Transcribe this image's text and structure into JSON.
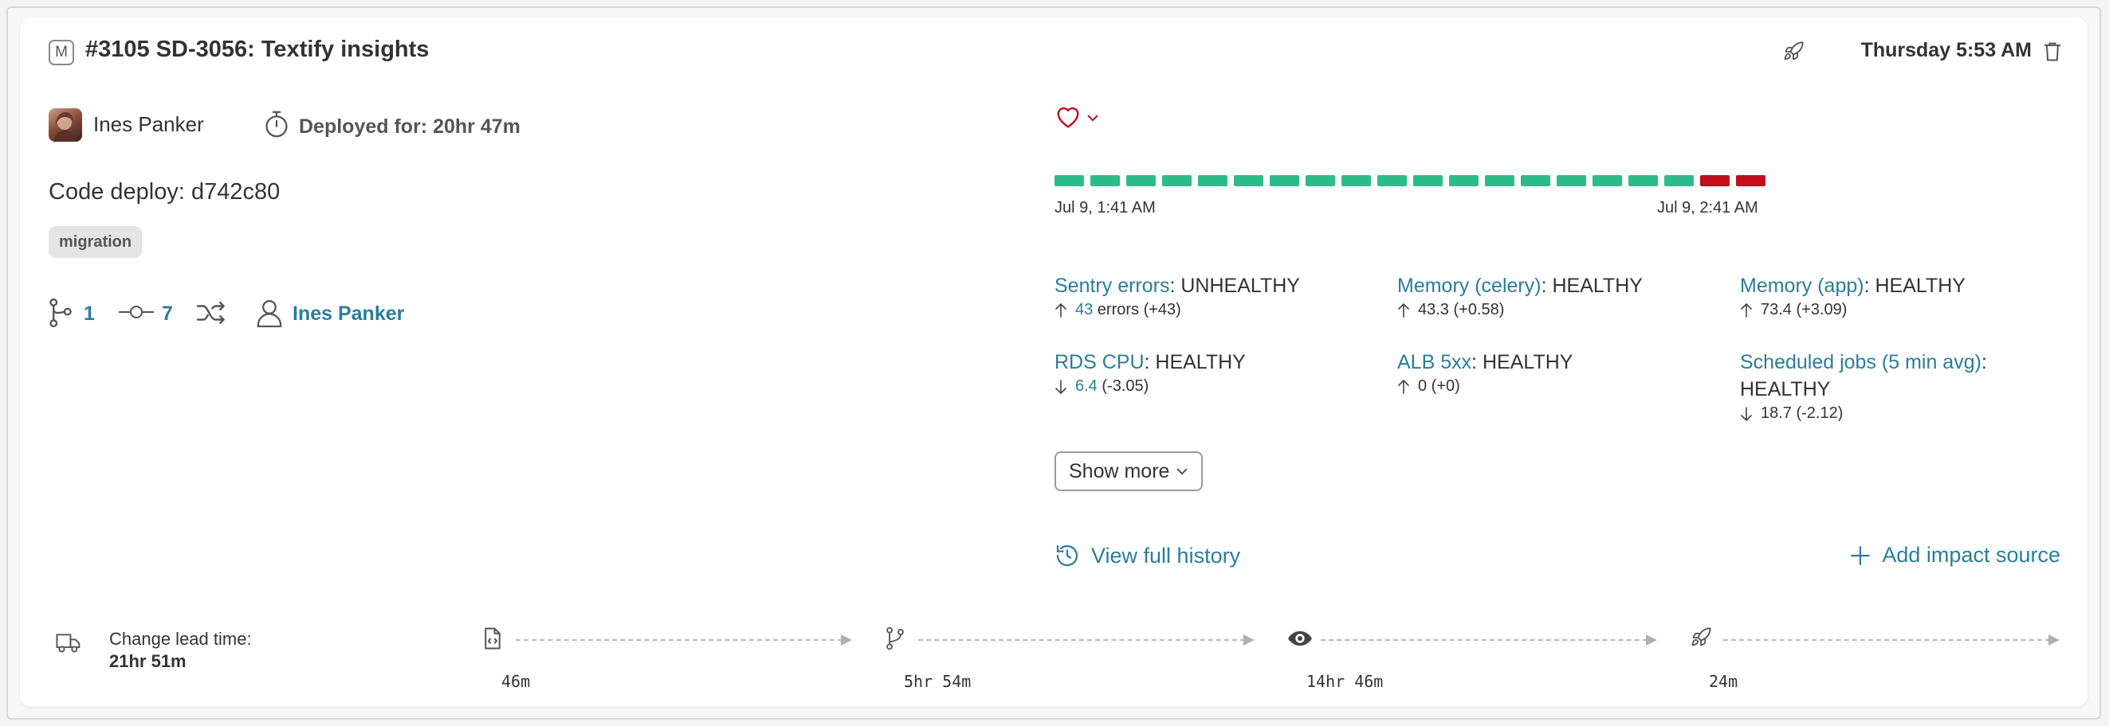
{
  "header": {
    "badge": "M",
    "title": "#3105 SD-3056: Textify insights",
    "deploy_time": "Thursday 5:53 AM"
  },
  "author": {
    "name": "Ines Panker",
    "deployed_for": "Deployed for: 20hr 47m"
  },
  "code_deploy": "Code deploy: d742c80",
  "tag": "migration",
  "meta": {
    "branches": "1",
    "commits": "7",
    "user": "Ines Panker"
  },
  "health": {
    "bars": [
      "ok",
      "ok",
      "ok",
      "ok",
      "ok",
      "ok",
      "ok",
      "ok",
      "ok",
      "ok",
      "ok",
      "ok",
      "ok",
      "ok",
      "ok",
      "ok",
      "ok",
      "ok",
      "bad",
      "bad"
    ],
    "colors": {
      "ok": "#2dbb8a",
      "bad": "#c0101e",
      "accent": "#2a7d9c"
    },
    "start_label": "Jul 9, 1:41 AM",
    "end_label": "Jul 9, 2:41 AM"
  },
  "metrics": [
    {
      "name": "Sentry errors",
      "status": ": UNHEALTHY",
      "direction": "up",
      "value": "43",
      "suffix": " errors (+43)",
      "value_link": true
    },
    {
      "name": "Memory (celery)",
      "status": ": HEALTHY",
      "direction": "up",
      "value": "43.3 (+0.58)",
      "suffix": "",
      "value_link": false
    },
    {
      "name": "Memory (app)",
      "status": ": HEALTHY",
      "direction": "up",
      "value": "73.4 (+3.09)",
      "suffix": "",
      "value_link": false
    },
    {
      "name": "RDS CPU",
      "status": ": HEALTHY",
      "direction": "down",
      "value": "6.4",
      "suffix": " (-3.05)",
      "value_link": true
    },
    {
      "name": "ALB 5xx",
      "status": ": HEALTHY",
      "direction": "up",
      "value": "0 (+0)",
      "suffix": "",
      "value_link": false
    },
    {
      "name": "Scheduled jobs (5 min avg)",
      "status": ":",
      "status2": "HEALTHY",
      "direction": "down",
      "value": "18.7 (-2.12)",
      "suffix": "",
      "value_link": false
    }
  ],
  "actions": {
    "show_more": "Show more",
    "view_history": "View full history",
    "add_impact": "Add impact source"
  },
  "lead_time": {
    "label": "Change lead time:",
    "value": "21hr 51m",
    "steps": [
      {
        "icon": "file-code-icon",
        "duration": "46m"
      },
      {
        "icon": "merge-icon",
        "duration": "5hr 54m"
      },
      {
        "icon": "eye-icon",
        "duration": "14hr 46m"
      },
      {
        "icon": "rocket-icon",
        "duration": "24m"
      }
    ]
  }
}
